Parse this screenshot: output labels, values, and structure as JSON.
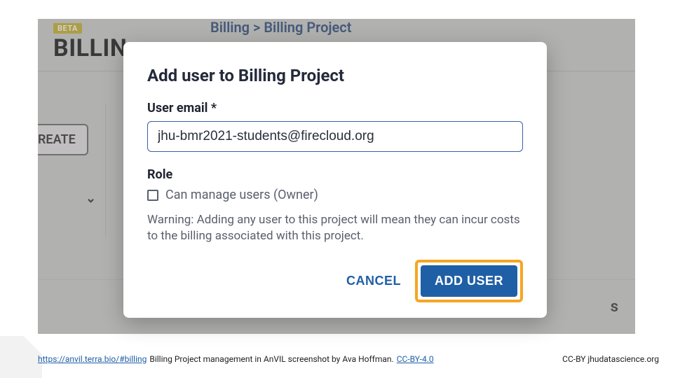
{
  "bg": {
    "beta": "BETA",
    "billing": "BILLIN",
    "breadcrumb": "Billing > Billing Project",
    "create": "REATE",
    "chevron": "⌄",
    "member_s": "s"
  },
  "modal": {
    "title": "Add user to Billing Project",
    "email_label": "User email *",
    "email_value": "jhu-bmr2021-students@firecloud.org",
    "role_label": "Role",
    "role_option": "Can manage users (Owner)",
    "warning": "Warning: Adding any user to this project will mean they can incur costs to the billing associated with this project.",
    "cancel": "CANCEL",
    "add_user": "ADD USER"
  },
  "footer": {
    "url_text": "https://anvil.terra.bio/#billing",
    "caption_mid": " Billing Project management in AnVIL screenshot by Ava Hoffman. ",
    "license_link": "CC-BY-4.0",
    "right": "CC-BY  jhudatascience.org"
  }
}
